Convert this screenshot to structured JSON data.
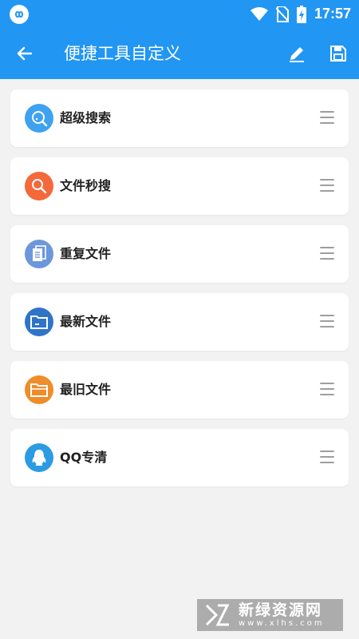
{
  "status_bar": {
    "time": "17:57"
  },
  "app_bar": {
    "title": "便捷工具自定义"
  },
  "items": [
    {
      "label": "超级搜索",
      "icon": "super-search-icon",
      "color": "#3fa2f0"
    },
    {
      "label": "文件秒搜",
      "icon": "file-quick-search-icon",
      "color": "#f4683a"
    },
    {
      "label": "重复文件",
      "icon": "duplicate-file-icon",
      "color": "#6c97db"
    },
    {
      "label": "最新文件",
      "icon": "latest-file-icon",
      "color": "#2f74c8"
    },
    {
      "label": "最旧文件",
      "icon": "oldest-file-icon",
      "color": "#ee8d2a"
    },
    {
      "label": "QQ专清",
      "icon": "qq-clean-icon",
      "color": "#2b9be2"
    }
  ],
  "watermark": {
    "title": "新绿资源网",
    "domain": "www.xlhs.com"
  }
}
